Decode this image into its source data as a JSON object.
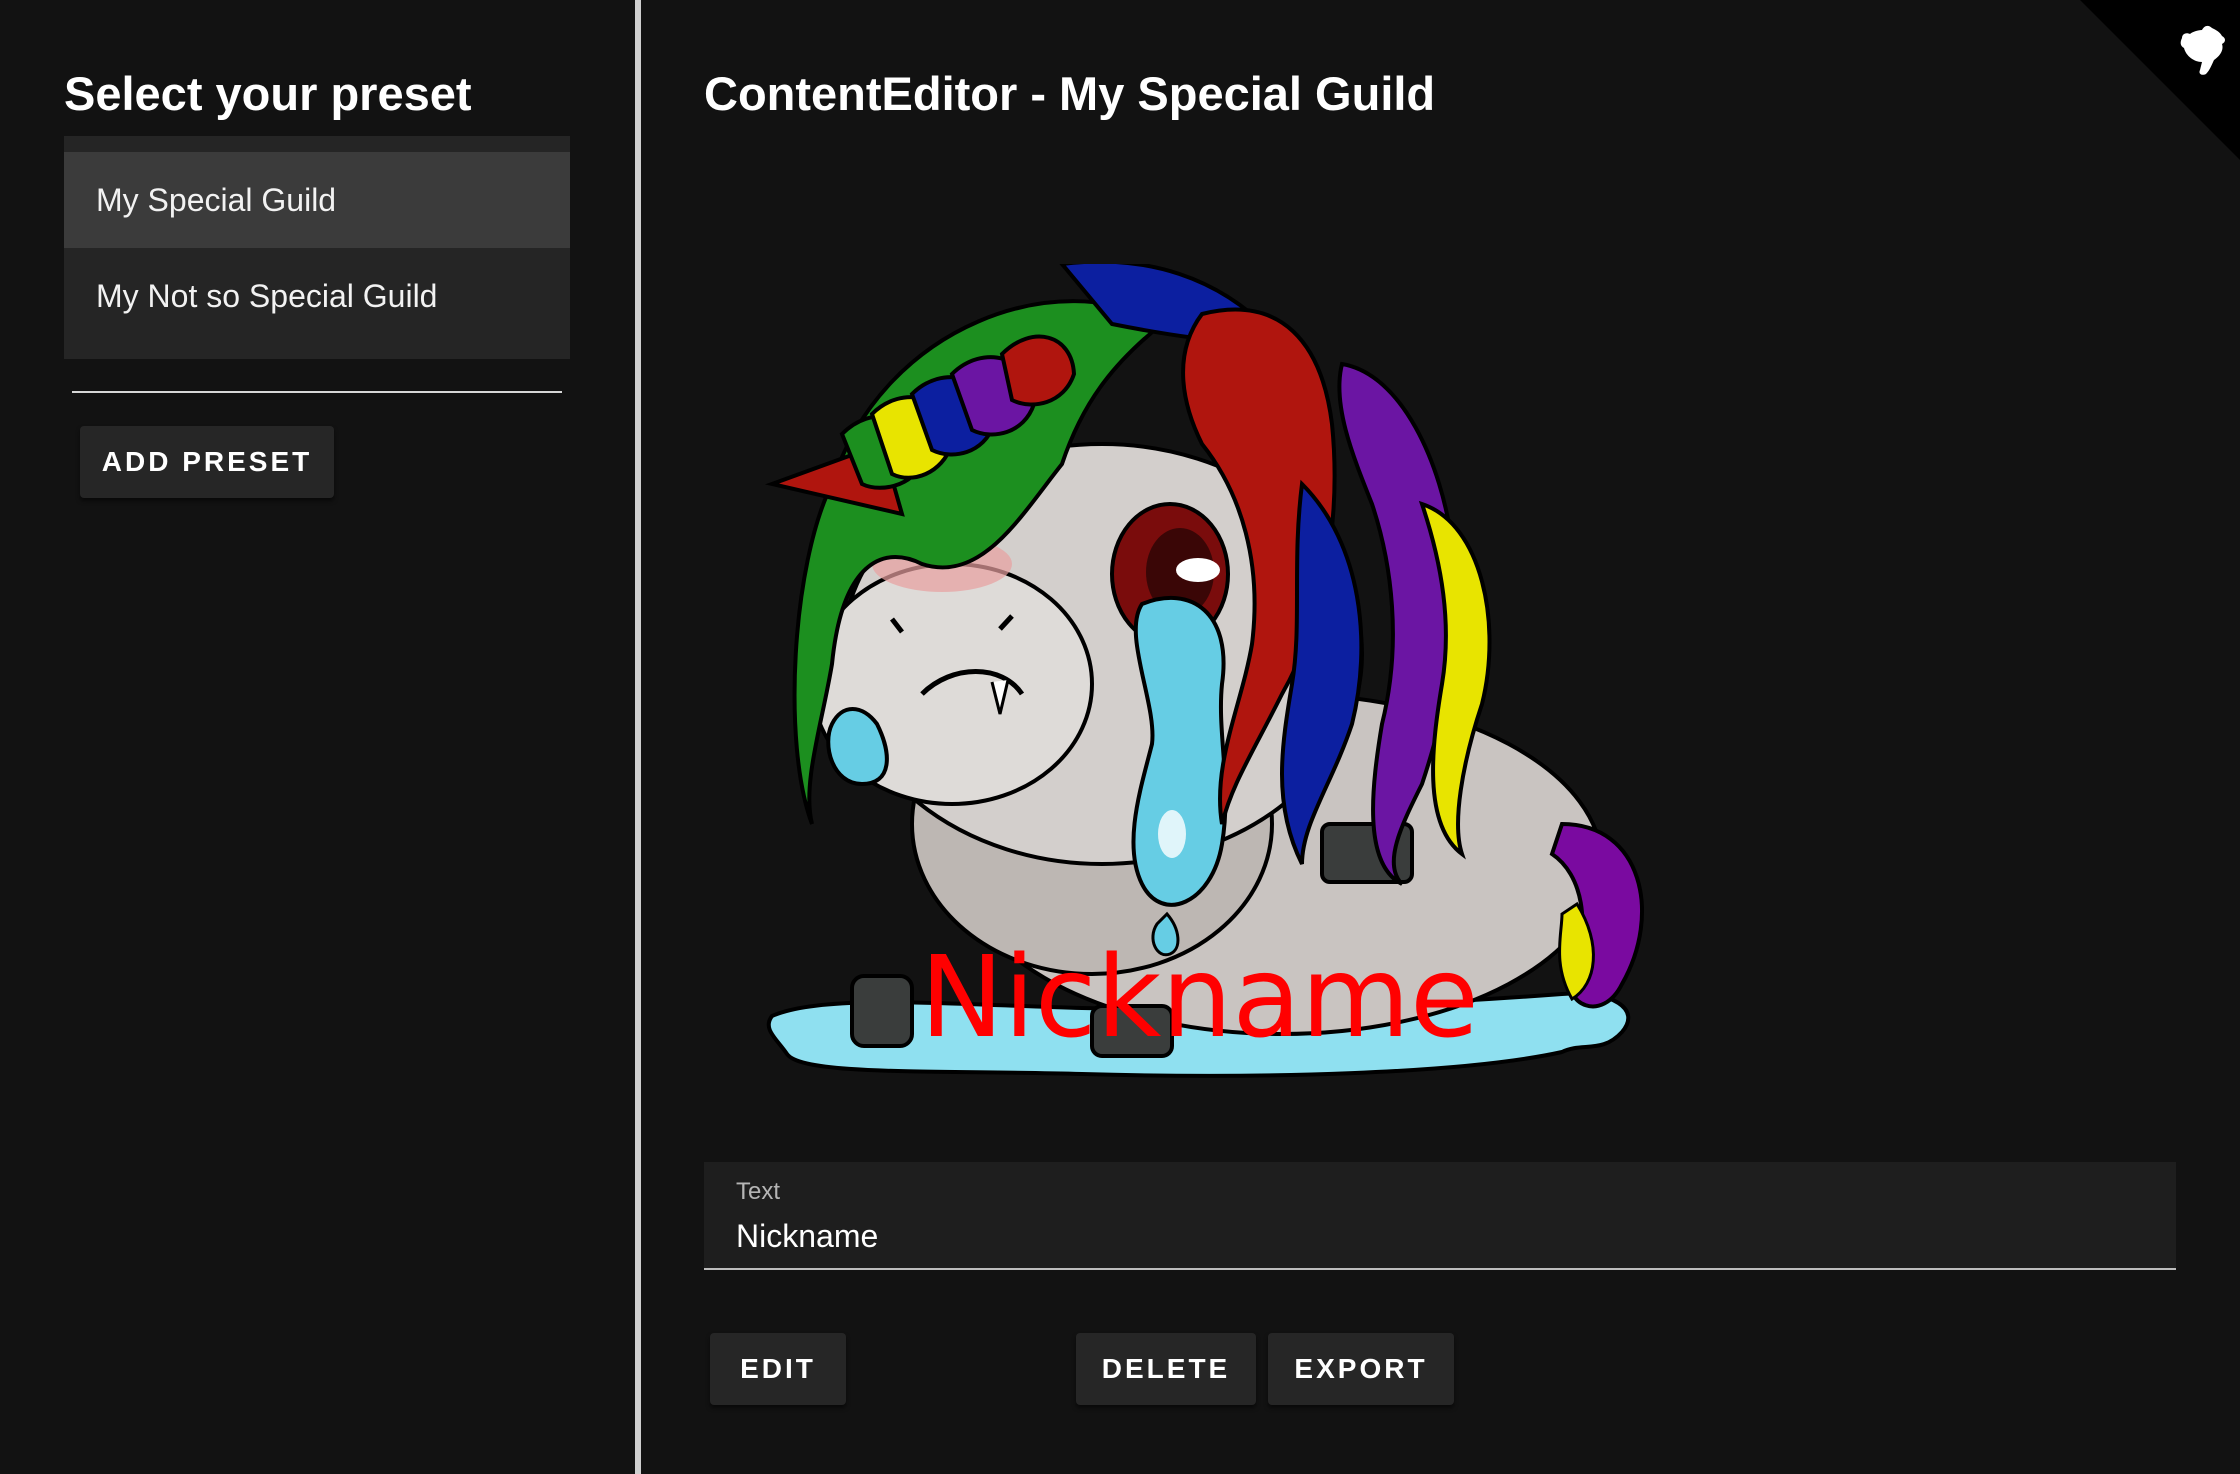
{
  "sidebar": {
    "title": "Select your preset",
    "presets": [
      {
        "label": "My Special Guild",
        "selected": true
      },
      {
        "label": "My Not so Special Guild",
        "selected": false
      }
    ],
    "add_button_label": "ADD PRESET"
  },
  "main": {
    "title": "ContentEditor - My Special Guild",
    "preview": {
      "image": "crying-unicorn-illustration",
      "overlay_text": "Nickname",
      "overlay_color": "#ff0000"
    },
    "text_field": {
      "label": "Text",
      "value": "Nickname"
    },
    "buttons": {
      "edit_label": "EDIT",
      "delete_label": "DELETE",
      "export_label": "EXPORT"
    }
  },
  "corner": {
    "icon": "github-cat-icon"
  },
  "colors": {
    "background": "#121212",
    "surface": "#252525",
    "selected": "#3b3b3b",
    "divider": "#cfcfcf",
    "text": "#ffffff"
  }
}
